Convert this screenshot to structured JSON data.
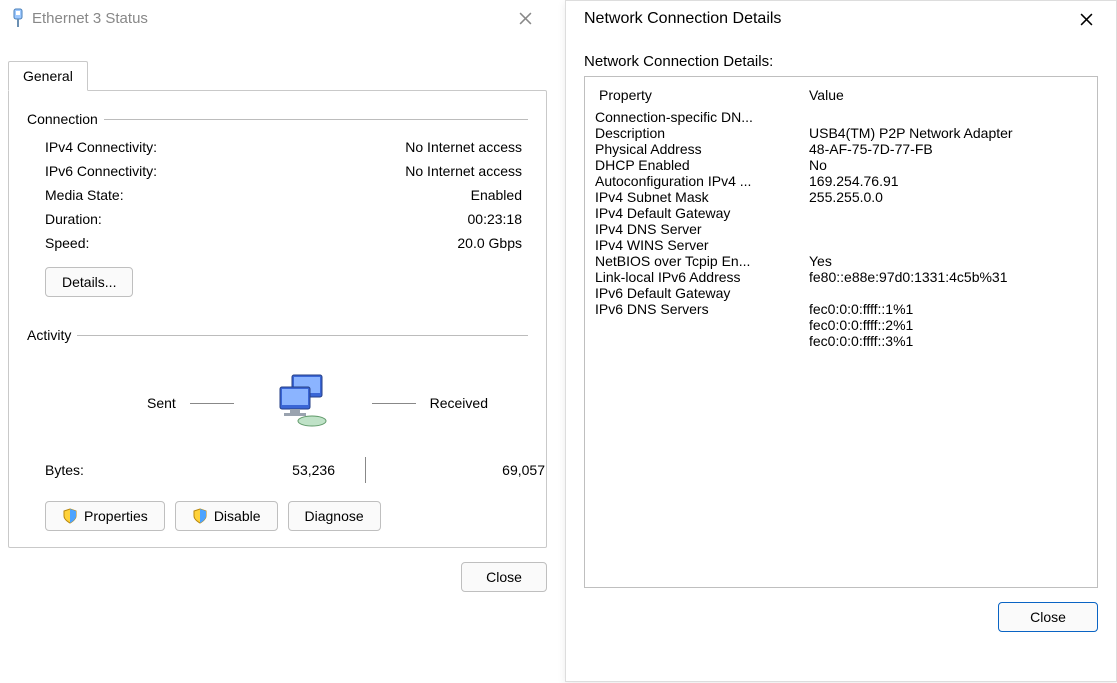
{
  "status": {
    "title": "Ethernet 3 Status",
    "tab_label": "General",
    "connection_label": "Connection",
    "rows": {
      "ipv4_k": "IPv4 Connectivity:",
      "ipv4_v": "No Internet access",
      "ipv6_k": "IPv6 Connectivity:",
      "ipv6_v": "No Internet access",
      "media_k": "Media State:",
      "media_v": "Enabled",
      "dur_k": "Duration:",
      "dur_v": "00:23:18",
      "speed_k": "Speed:",
      "speed_v": "20.0 Gbps"
    },
    "details_btn": "Details...",
    "activity_label": "Activity",
    "sent_label": "Sent",
    "received_label": "Received",
    "bytes_label": "Bytes:",
    "bytes_sent": "53,236",
    "bytes_recv": "69,057",
    "properties_btn": "Properties",
    "disable_btn": "Disable",
    "diagnose_btn": "Diagnose",
    "close_btn": "Close"
  },
  "details": {
    "title": "Network Connection Details",
    "caption": "Network Connection Details:",
    "col_property": "Property",
    "col_value": "Value",
    "rows": [
      {
        "p": "Connection-specific DN...",
        "v": ""
      },
      {
        "p": "Description",
        "v": "USB4(TM) P2P Network Adapter"
      },
      {
        "p": "Physical Address",
        "v": "48-AF-75-7D-77-FB"
      },
      {
        "p": "DHCP Enabled",
        "v": "No"
      },
      {
        "p": "Autoconfiguration IPv4 ...",
        "v": "169.254.76.91"
      },
      {
        "p": "IPv4 Subnet Mask",
        "v": "255.255.0.0"
      },
      {
        "p": "IPv4 Default Gateway",
        "v": ""
      },
      {
        "p": "IPv4 DNS Server",
        "v": ""
      },
      {
        "p": "IPv4 WINS Server",
        "v": ""
      },
      {
        "p": "NetBIOS over Tcpip En...",
        "v": "Yes"
      },
      {
        "p": "Link-local IPv6 Address",
        "v": "fe80::e88e:97d0:1331:4c5b%31"
      },
      {
        "p": "IPv6 Default Gateway",
        "v": ""
      },
      {
        "p": "IPv6 DNS Servers",
        "v": "fec0:0:0:ffff::1%1"
      },
      {
        "p": "",
        "v": "fec0:0:0:ffff::2%1"
      },
      {
        "p": "",
        "v": "fec0:0:0:ffff::3%1"
      }
    ],
    "close_btn": "Close"
  }
}
